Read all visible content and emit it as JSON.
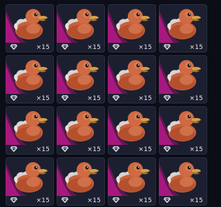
{
  "inventory": {
    "accent_color": "#c0188c",
    "item_icon": "rubber-duck-icon",
    "currency_icon": "gem-icon",
    "items": [
      {
        "count": "×15"
      },
      {
        "count": "×15"
      },
      {
        "count": "×15"
      },
      {
        "count": "×15"
      },
      {
        "count": "×15"
      },
      {
        "count": "×15"
      },
      {
        "count": "×15"
      },
      {
        "count": "×15"
      },
      {
        "count": "×15"
      },
      {
        "count": "×15"
      },
      {
        "count": "×15"
      },
      {
        "count": "×15"
      },
      {
        "count": "×15"
      },
      {
        "count": "×15"
      },
      {
        "count": "×15"
      },
      {
        "count": "×15"
      }
    ]
  }
}
